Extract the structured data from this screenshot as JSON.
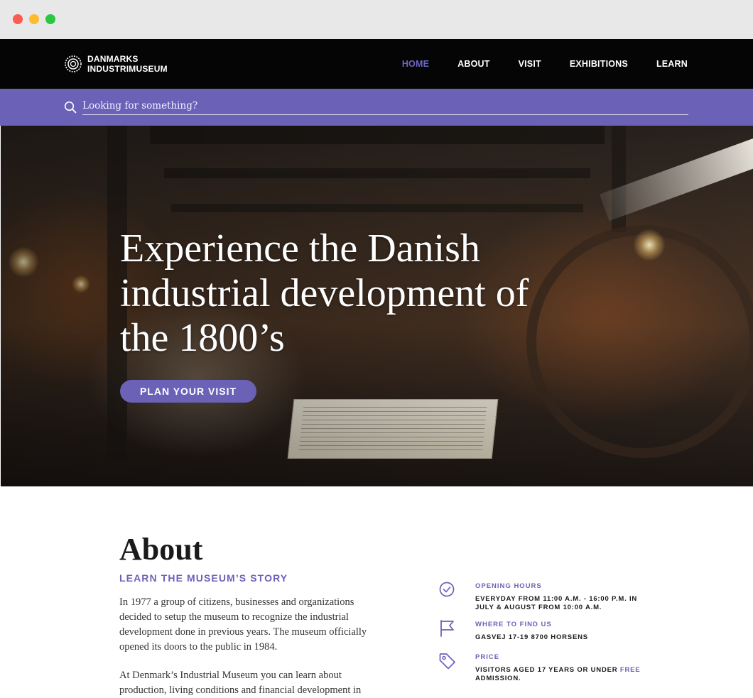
{
  "window": {
    "controls": [
      "close",
      "minimize",
      "maximize"
    ]
  },
  "brand": {
    "line1": "DANMARKS",
    "line2": "INDUSTRIMUSEUM",
    "icon": "gear-logo-icon"
  },
  "nav": {
    "items": [
      "HOME",
      "ABOUT",
      "VISIT",
      "EXHIBITIONS",
      "LEARN"
    ],
    "active": "HOME",
    "active_color": "#6b66c4"
  },
  "search": {
    "placeholder": "Looking for something?",
    "icon": "search-icon",
    "bar_color": "#6b62b8"
  },
  "hero": {
    "title": "Experience the Danish industrial development of the 1800’s",
    "cta": "PLAN YOUR VISIT"
  },
  "about": {
    "title": "About",
    "subtitle": "LEARN THE MUSEUM’S STORY",
    "p1": "In 1977 a group of citizens, businesses and organizations decided to setup the museum to recognize the industrial development done in previous years. The museum officially opened its doors to the public in 1984.",
    "p2": "At Denmark’s Industrial Museum you can learn about production, living conditions and financial development in"
  },
  "info": {
    "hours": {
      "icon": "clock-check-icon",
      "label": "OPENING HOURS",
      "value": "EVERYDAY FROM 11:00 A.M. - 16:00 P.M. IN JULY & AUGUST FROM 10:00 A.M."
    },
    "location": {
      "icon": "flag-icon",
      "label": "WHERE TO FIND US",
      "value": "GASVEJ 17-19 8700 HORSENS"
    },
    "price": {
      "icon": "price-tag-icon",
      "label": "PRICE",
      "value_before": "VISITORS AGED 17 YEARS OR UNDER",
      "value_highlight": "FREE",
      "value_after": "ADMISSION."
    }
  },
  "colors": {
    "accent": "#6b62b8",
    "navbar": "#050505",
    "chrome": "#e8e8e8"
  }
}
